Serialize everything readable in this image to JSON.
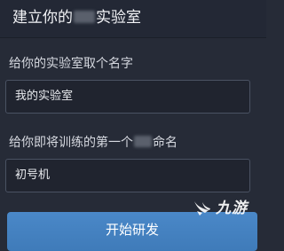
{
  "header": {
    "title_prefix": "建立你的",
    "title_suffix": "实验室"
  },
  "lab_name": {
    "label": "给你的实验室取个名字",
    "value": "我的实验室"
  },
  "first_trainee": {
    "label_prefix": "给你即将训练的第一个",
    "label_suffix": "命名",
    "value": "初号机"
  },
  "actions": {
    "start_label": "开始研发"
  },
  "watermark": {
    "text": "九游"
  },
  "colors": {
    "background": "#262b37",
    "button": "#4483c2",
    "input_border": "#4a5263"
  }
}
